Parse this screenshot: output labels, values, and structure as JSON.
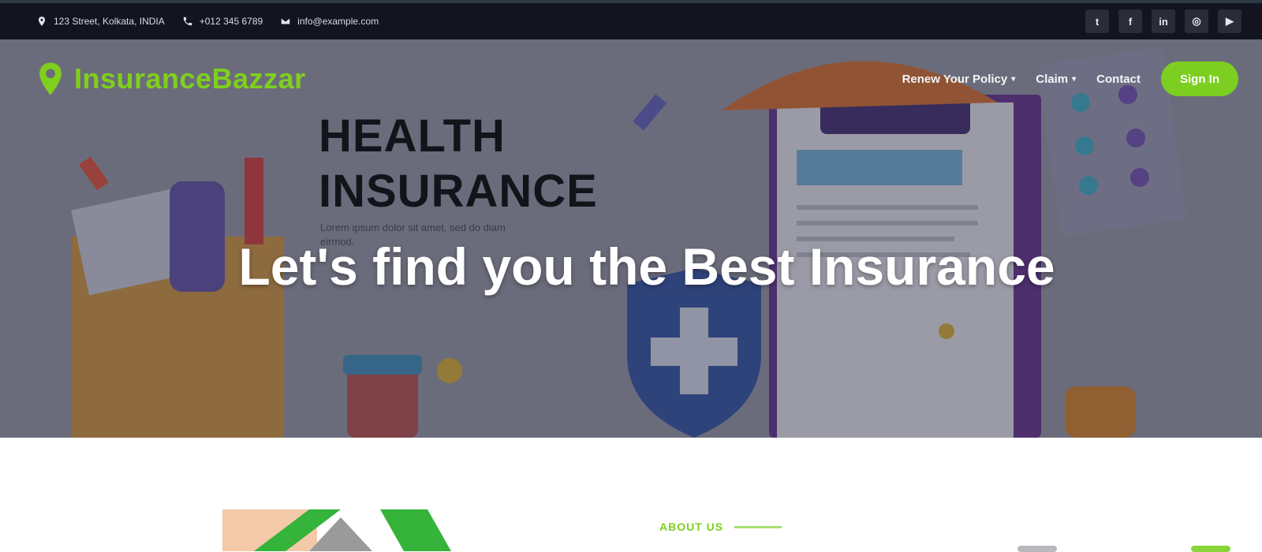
{
  "topbar": {
    "address": "123 Street, Kolkata, INDIA",
    "phone": "+012 345 6789",
    "email": "info@example.com",
    "social": [
      {
        "icon": "twitter-icon",
        "glyph": "t"
      },
      {
        "icon": "facebook-icon",
        "glyph": "f"
      },
      {
        "icon": "linkedin-icon",
        "glyph": "in"
      },
      {
        "icon": "instagram-icon",
        "glyph": "◎"
      },
      {
        "icon": "youtube-icon",
        "glyph": "▶"
      }
    ]
  },
  "brand": {
    "name": "InsuranceBazzar",
    "accent": "#7fcf1e"
  },
  "nav": {
    "items": [
      {
        "label": "Renew Your Policy",
        "has_dropdown": true
      },
      {
        "label": "Claim",
        "has_dropdown": true
      },
      {
        "label": "Contact",
        "has_dropdown": false
      }
    ],
    "signin_label": "Sign In"
  },
  "hero": {
    "art_title_line1": "HEALTH",
    "art_title_line2": "INSURANCE",
    "art_subtitle": "Lorem ipsum dolor sit amet, sed do diam eirmod.",
    "headline": "Let's find you the Best Insurance"
  },
  "about": {
    "label": "ABOUT US"
  }
}
